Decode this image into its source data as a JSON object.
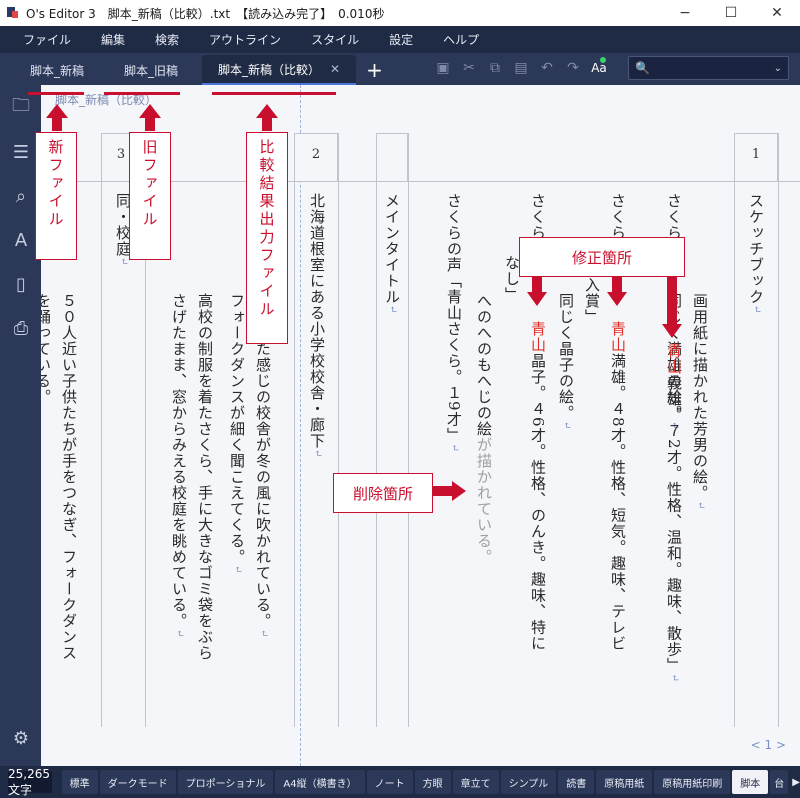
{
  "titlebar": {
    "title": "O's Editor 3　脚本_新稿（比較）.txt　【読み込み完了】　0.010秒",
    "minimize": "−",
    "maximize": "☐",
    "close": "✕"
  },
  "menu": [
    "ファイル",
    "編集",
    "検索",
    "アウトライン",
    "スタイル",
    "設定",
    "ヘルプ"
  ],
  "tabs": [
    {
      "label": "脚本_新稿"
    },
    {
      "label": "脚本_旧稿"
    },
    {
      "label": "脚本_新稿（比較）",
      "close": "✕"
    }
  ],
  "add_tab": "+",
  "search": {
    "icon": "🔍",
    "dropdown": "⌄"
  },
  "sidebar_icons": [
    "folder-icon",
    "outline-list-icon",
    "search-icon",
    "font-size-icon",
    "pdf-icon",
    "print-icon",
    "settings-icon"
  ],
  "document": {
    "name": "脚本_新稿（比較）",
    "scene_numbers": {
      "s1": "1",
      "s2": "2",
      "s3": "3"
    },
    "columns": {
      "c1": "スケッチブック",
      "c2a": "画用紙に描かれた芳男の絵。",
      "c3a_1": "さくらの声",
      "c3a_2": "同じく満雄の絵。",
      "c3b_red": "青山",
      "c3b_rest": "義雄。７2才。性格、温和。趣味、散歩」",
      "c4a_1": "さくらの声",
      "c4a_2": "佳作入賞」",
      "c4b_1": "同じく晶子の絵。",
      "c4c_red": "青山",
      "c4c_rest": "満雄。４8才。性格、短気。趣味、テレビ",
      "c5a_1": "さくらの声",
      "c5a_2": "なし」",
      "c5b_red": "青山",
      "c5b_rest": "晶子。４6才。性格、のんき。趣味、特に",
      "c6a": "へのへのもへじの絵",
      "c6a_gray": "が描かれている。",
      "c7": "さくらの声「青山さくら。１9才」",
      "c8": "メインタイトル",
      "c9": "北海道根室にある小学校校舎・廊下",
      "c10a": "さびれた感じの校舎が冬の風に吹かれている。",
      "c10b": "フォークダンスが細く聞こえてくる。",
      "c11a": "高校の制服を着たさくら、手に大きなゴミ袋をぶら",
      "c11b": "さげたまま、窓からみえる校庭を眺めている。",
      "c12a": "同・校庭",
      "c13a": "５０人近い子供たちが手をつなぎ、フォークダンス",
      "c13b": "を踊っている。",
      "return_mark": "↵"
    },
    "pager": "< 1 >"
  },
  "status": {
    "char_count": "25,265文字",
    "buttons": [
      "標準",
      "ダークモード",
      "プロポーショナル",
      "A4縦（横書き）",
      "ノート",
      "方眼",
      "章立て",
      "シンプル",
      "読書",
      "原稿用紙",
      "原稿用紙印刷",
      "脚本",
      "台"
    ],
    "active": "脚本",
    "arrow": "▶"
  },
  "annotations": {
    "new_file": "新ファイル",
    "old_file": "旧ファイル",
    "compare_file": "比較結果出力ファイル",
    "modified": "修正箇所",
    "deleted": "削除箇所"
  },
  "colors": {
    "accent_red": "#c8102e",
    "diff_red": "#e2312b",
    "navy": "#1f2a44"
  }
}
